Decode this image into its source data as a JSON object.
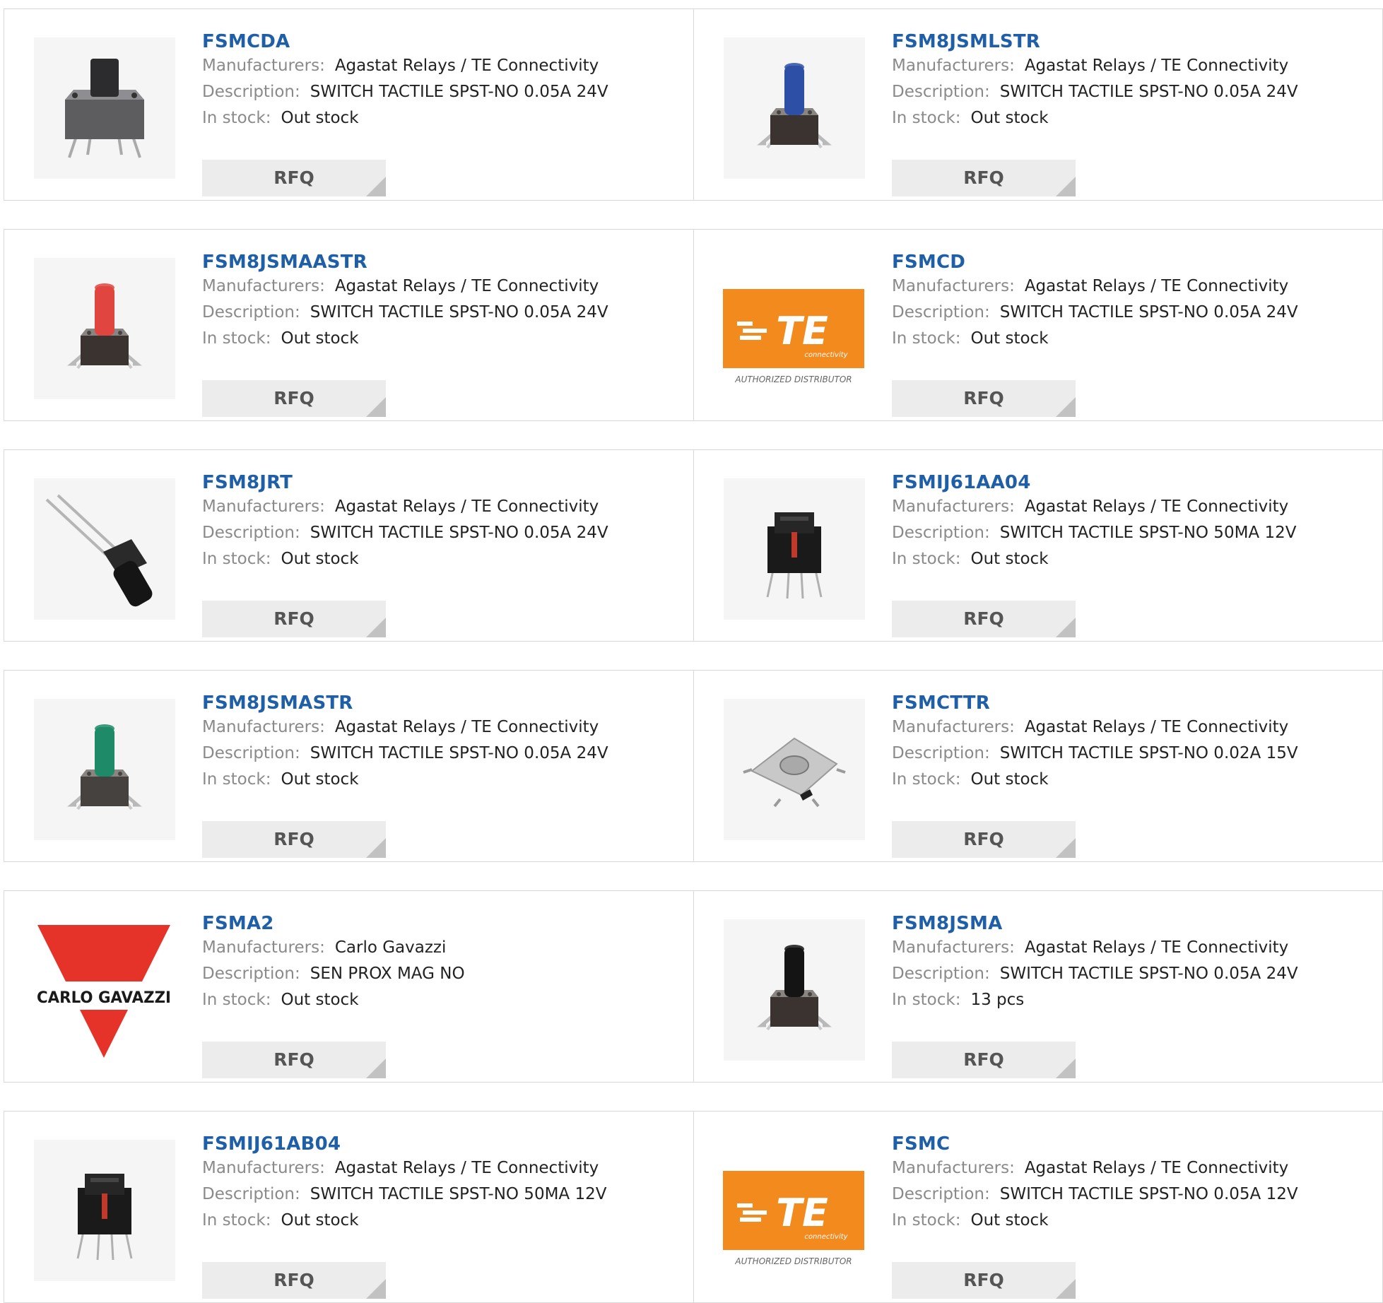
{
  "labels": {
    "manufacturers": "Manufacturers:",
    "description": "Description:",
    "in_stock": "In stock:",
    "rfq": "RFQ"
  },
  "logos": {
    "te_mark": "TE",
    "te_sub": "connectivity",
    "te_tagline": "AUTHORIZED DISTRIBUTOR",
    "carlo_gavazzi": "CARLO GAVAZZI"
  },
  "colors": {
    "part_link": "#1f5fa8",
    "te_orange": "#f28a1e",
    "carlo_gavazzi_red": "#e63329"
  },
  "products": [
    {
      "part": "FSMCDA",
      "manufacturer": "Agastat Relays / TE Connectivity",
      "description": "SWITCH TACTILE SPST-NO 0.05A 24V",
      "stock": "Out stock",
      "image": "tactile-switch-dark-short"
    },
    {
      "part": "FSM8JSMLSTR",
      "manufacturer": "Agastat Relays / TE Connectivity",
      "description": "SWITCH TACTILE SPST-NO 0.05A 24V",
      "stock": "Out stock",
      "image": "tactile-switch-blue"
    },
    {
      "part": "FSM8JSMAASTR",
      "manufacturer": "Agastat Relays / TE Connectivity",
      "description": "SWITCH TACTILE SPST-NO 0.05A 24V",
      "stock": "Out stock",
      "image": "tactile-switch-red"
    },
    {
      "part": "FSMCD",
      "manufacturer": "Agastat Relays / TE Connectivity",
      "description": "SWITCH TACTILE SPST-NO 0.05A 24V",
      "stock": "Out stock",
      "image": "te-connectivity-logo"
    },
    {
      "part": "FSM8JRT",
      "manufacturer": "Agastat Relays / TE Connectivity",
      "description": "SWITCH TACTILE SPST-NO 0.05A 24V",
      "stock": "Out stock",
      "image": "right-angle-tactile-switch"
    },
    {
      "part": "FSMIJ61AA04",
      "manufacturer": "Agastat Relays / TE Connectivity",
      "description": "SWITCH TACTILE SPST-NO 50MA 12V",
      "stock": "Out stock",
      "image": "illuminated-tactile-switch"
    },
    {
      "part": "FSM8JSMASTR",
      "manufacturer": "Agastat Relays / TE Connectivity",
      "description": "SWITCH TACTILE SPST-NO 0.05A 24V",
      "stock": "Out stock",
      "image": "tactile-switch-green"
    },
    {
      "part": "FSMCTTR",
      "manufacturer": "Agastat Relays / TE Connectivity",
      "description": "SWITCH TACTILE SPST-NO 0.02A 15V",
      "stock": "Out stock",
      "image": "smd-tactile-switch-flat"
    },
    {
      "part": "FSMA2",
      "manufacturer": "Carlo Gavazzi",
      "description": "SEN PROX MAG NO",
      "stock": "Out stock",
      "image": "carlo-gavazzi-logo"
    },
    {
      "part": "FSM8JSMA",
      "manufacturer": "Agastat Relays / TE Connectivity",
      "description": "SWITCH TACTILE SPST-NO 0.05A 24V",
      "stock": "13 pcs",
      "image": "tactile-switch-black"
    },
    {
      "part": "FSMIJ61AB04",
      "manufacturer": "Agastat Relays / TE Connectivity",
      "description": "SWITCH TACTILE SPST-NO 50MA 12V",
      "stock": "Out stock",
      "image": "illuminated-tactile-switch"
    },
    {
      "part": "FSMC",
      "manufacturer": "Agastat Relays / TE Connectivity",
      "description": "SWITCH TACTILE SPST-NO 0.05A 12V",
      "stock": "Out stock",
      "image": "te-connectivity-logo"
    }
  ]
}
